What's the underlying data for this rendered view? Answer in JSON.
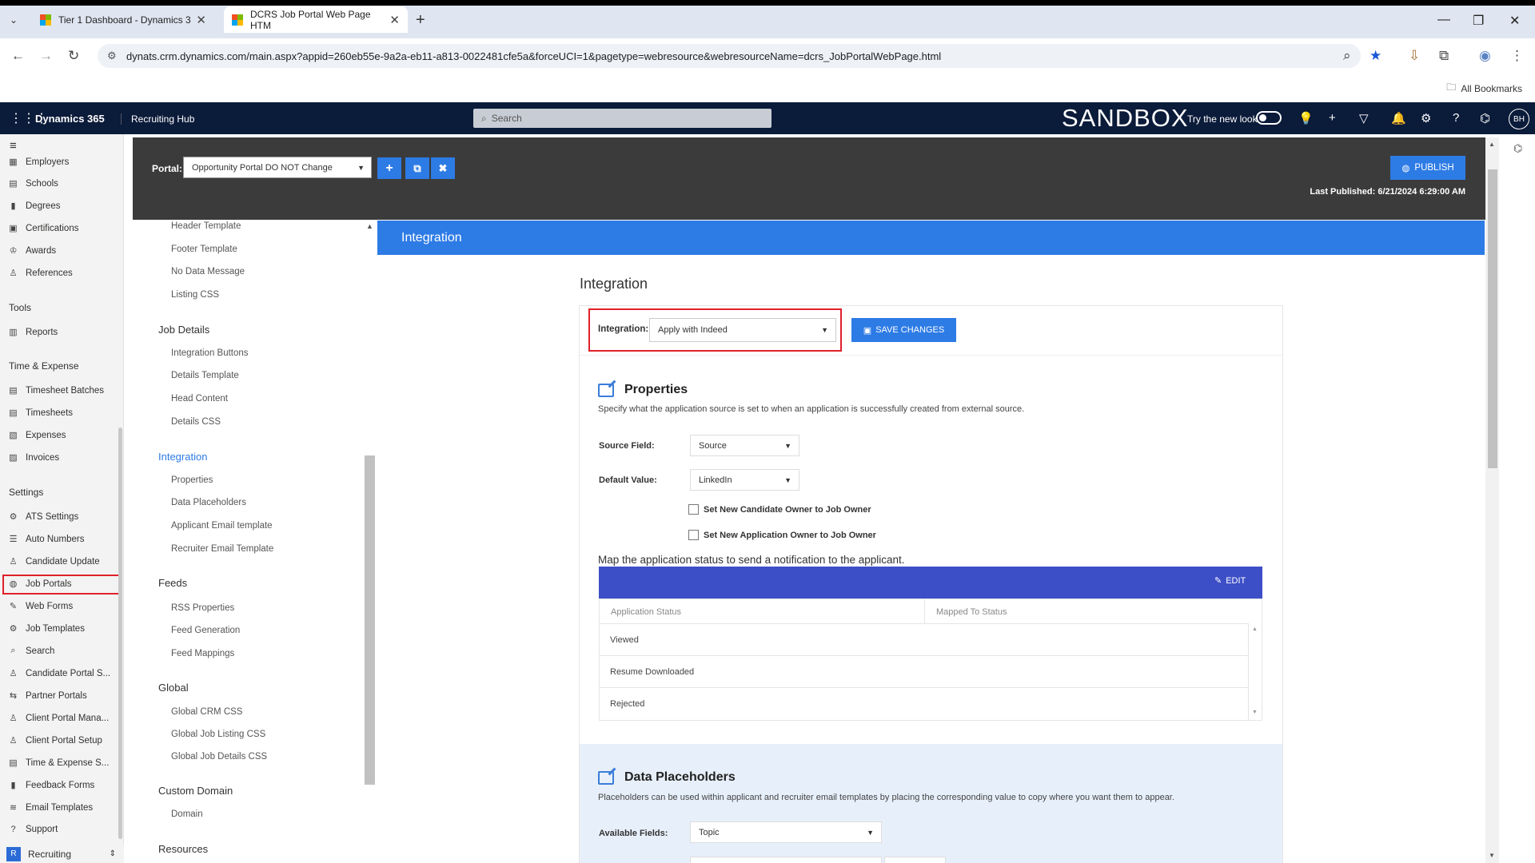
{
  "browser": {
    "tabs": [
      {
        "label": "Tier 1 Dashboard - Dynamics 3"
      },
      {
        "label": "DCRS Job Portal Web Page HTM"
      }
    ],
    "url": "dynats.crm.dynamics.com/main.aspx?appid=260eb55e-9a2a-eb11-a813-0022481cfe5a&forceUCI=1&pagetype=webresource&webresourceName=dcrs_JobPortalWebPage.html",
    "all_bookmarks": "All Bookmarks"
  },
  "header": {
    "brand": "Dynamics 365",
    "app": "Recruiting Hub",
    "search_placeholder": "Search",
    "env": "SANDBOX",
    "try_new_look": "Try the new look",
    "avatar": "BH"
  },
  "leftnav": {
    "items": [
      {
        "label": "Employers",
        "icon": "users-icon"
      },
      {
        "label": "Schools",
        "icon": "school-icon"
      },
      {
        "label": "Degrees",
        "icon": "book-icon"
      },
      {
        "label": "Certifications",
        "icon": "certificate-icon"
      },
      {
        "label": "Awards",
        "icon": "award-icon"
      },
      {
        "label": "References",
        "icon": "person-icon"
      }
    ],
    "tools_label": "Tools",
    "tools": [
      {
        "label": "Reports"
      }
    ],
    "time_label": "Time & Expense",
    "time": [
      {
        "label": "Timesheet Batches"
      },
      {
        "label": "Timesheets"
      },
      {
        "label": "Expenses"
      },
      {
        "label": "Invoices"
      }
    ],
    "settings_label": "Settings",
    "settings": [
      {
        "label": "ATS Settings"
      },
      {
        "label": "Auto Numbers"
      },
      {
        "label": "Candidate Update"
      },
      {
        "label": "Job Portals"
      },
      {
        "label": "Web Forms"
      },
      {
        "label": "Job Templates"
      },
      {
        "label": "Search"
      },
      {
        "label": "Candidate Portal S..."
      },
      {
        "label": "Partner Portals"
      },
      {
        "label": "Client Portal Mana..."
      },
      {
        "label": "Client Portal Setup"
      },
      {
        "label": "Time & Expense S..."
      },
      {
        "label": "Feedback Forms"
      },
      {
        "label": "Email Templates"
      },
      {
        "label": "Support"
      }
    ],
    "area": "Recruiting",
    "area_badge": "R"
  },
  "portalbar": {
    "label": "Portal:",
    "selected": "Opportunity Portal DO NOT Change",
    "publish": "PUBLISH",
    "last_published": "Last Published: 6/21/2024 6:29:00 AM"
  },
  "secnav": {
    "top_items": [
      "Header Template",
      "Footer Template",
      "No Data Message",
      "Listing CSS"
    ],
    "job_details": "Job Details",
    "job_details_items": [
      "Integration Buttons",
      "Details Template",
      "Head Content",
      "Details CSS"
    ],
    "integration": "Integration",
    "integration_items": [
      "Properties",
      "Data Placeholders",
      "Applicant Email template",
      "Recruiter Email Template"
    ],
    "feeds": "Feeds",
    "feeds_items": [
      "RSS Properties",
      "Feed Generation",
      "Feed Mappings"
    ],
    "global": "Global",
    "global_items": [
      "Global CRM CSS",
      "Global Job Listing CSS",
      "Global Job Details CSS"
    ],
    "custom_domain": "Custom Domain",
    "custom_domain_items": [
      "Domain"
    ],
    "resources": "Resources"
  },
  "main": {
    "banner": "Integration",
    "title": "Integration",
    "integration_label": "Integration:",
    "integration_value": "Apply with Indeed",
    "save": "SAVE CHANGES",
    "properties": {
      "title": "Properties",
      "desc": "Specify what the application source is set to when an application is successfully created from external source.",
      "source_field_label": "Source Field:",
      "source_field_value": "Source",
      "default_value_label": "Default Value:",
      "default_value_value": "LinkedIn",
      "chk1": "Set New Candidate Owner to Job Owner",
      "chk2": "Set New Application Owner to Job Owner"
    },
    "map_desc": "Map the application status to send a notification to the applicant.",
    "edit": "EDIT",
    "grid_cols": [
      "Application Status",
      "Mapped To Status"
    ],
    "grid_rows": [
      "Viewed",
      "Resume Downloaded",
      "Rejected"
    ],
    "placeholders": {
      "title": "Data Placeholders",
      "desc": "Placeholders can be used within applicant and recruiter email templates by placing the corresponding value to copy where you want them to appear.",
      "available_label": "Available Fields:",
      "available_value": "Topic"
    }
  },
  "colors": {
    "accent": "#2d7be5",
    "header": "#0b1b3a",
    "highlight": "#e0202a",
    "grid_header": "#3d4fc7"
  }
}
